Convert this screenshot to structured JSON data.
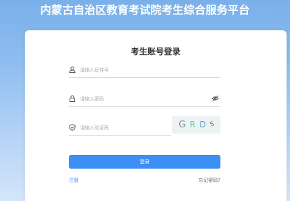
{
  "banner": {
    "title": "内蒙古自治区教育考试院考生综合服务平台"
  },
  "login": {
    "title": "考生账号登录",
    "id_placeholder": "请输入证件号",
    "password_placeholder": "请输入密码",
    "captcha_placeholder": "请输入验证码",
    "captcha_chars": [
      "G",
      "R",
      "D",
      "S"
    ],
    "captcha_colors": [
      "#7a8e9e",
      "#6fc8a0",
      "#5c9fd0",
      "#7a6a5a"
    ],
    "login_button": "登录",
    "register_link": "注册",
    "forgot_link": "忘记密码?"
  },
  "icons": [
    "user-icon",
    "lock-icon",
    "shield-icon",
    "eye-icon"
  ],
  "colors": {
    "primary": "#3d8ef5",
    "banner_text": "#ffffff"
  }
}
